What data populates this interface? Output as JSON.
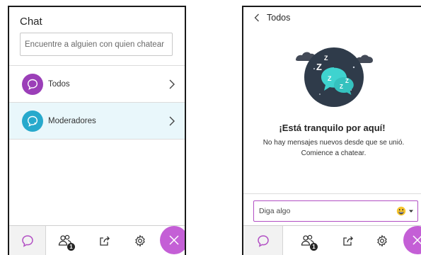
{
  "left": {
    "title": "Chat",
    "search": {
      "placeholder": "Encuentre a alguien con quien chatear",
      "value": ""
    },
    "items": [
      {
        "label": "Todos",
        "color": "#9b3fb8"
      },
      {
        "label": "Moderadores",
        "color": "#27a9cc"
      }
    ],
    "tabs": {
      "participants_badge": "1"
    }
  },
  "right": {
    "header": {
      "title": "Todos"
    },
    "empty_state": {
      "title": "¡Está tranquilo por aquí!",
      "body": "No hay mensajes nuevos desde que se unió. Comience a chatear."
    },
    "compose": {
      "placeholder": "Diga algo",
      "value": ""
    }
  },
  "colors": {
    "accent": "#c45fd6",
    "compose_border": "#b24fc4",
    "highlight_row": "#e9f7fb",
    "illustration_circle": "#2f3b4a",
    "bubble": "#3fd3cf"
  },
  "icons": [
    "chat-bubble-icon",
    "participants-icon",
    "share-icon",
    "gear-icon",
    "close-icon",
    "chevron-right-icon",
    "chevron-left-icon",
    "emoji-icon",
    "caret-down-icon"
  ]
}
